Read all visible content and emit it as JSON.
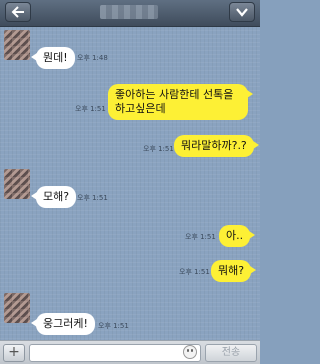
{
  "messages": [
    {
      "text": "뭔데!",
      "time": "오후 1:48"
    },
    {
      "text1": "좋아하는 사람한테 선톡을",
      "text2": "하고싶은데",
      "time": "오후 1:51"
    },
    {
      "text": "뭐라말하까?.?",
      "time": "오후 1:51"
    },
    {
      "text": "모해?",
      "time": "오후 1:51"
    },
    {
      "text": "아..",
      "time": "오후 1:51"
    },
    {
      "text": "뭐해?",
      "time": "오후 1:51"
    },
    {
      "text": "웅그러케!",
      "time": "오후 1:51"
    }
  ],
  "input": {
    "plus": "+",
    "send_label": "전송"
  },
  "colors": {
    "sent_bubble": "#fdf035",
    "received_bubble": "#ffffff",
    "chat_background": "#8aa3c0"
  }
}
